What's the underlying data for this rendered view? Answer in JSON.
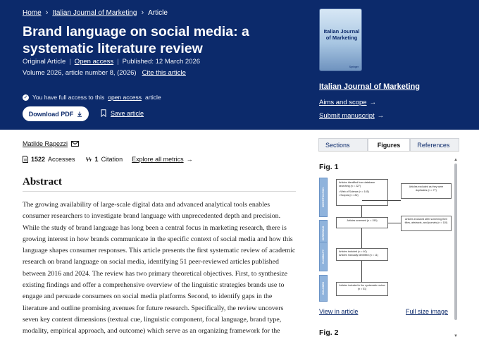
{
  "breadcrumb": {
    "home": "Home",
    "journal": "Italian Journal of Marketing",
    "current": "Article",
    "sep": "›"
  },
  "article": {
    "title": "Brand language on social media: a systematic literature review",
    "type": "Original Article",
    "access": "Open access",
    "published": "Published: 12 March 2026",
    "volume": "Volume 2026, article number 8, (2026)",
    "cite": "Cite this article",
    "full_access_pre": "You have full access to this",
    "full_access_link": "open access",
    "full_access_post": "article",
    "download": "Download PDF",
    "save": "Save article"
  },
  "journal": {
    "cover_title": "Italian Journal of Marketing",
    "cover_publisher": "Springer",
    "name": "Italian Journal of Marketing",
    "aims": "Aims and scope",
    "submit": "Submit manuscript",
    "arrow": "→"
  },
  "author": {
    "name": "Matilde Rapezzi"
  },
  "metrics": {
    "accesses_count": "1522",
    "accesses_label": "Accesses",
    "citations_count": "1",
    "citations_label": "Citation",
    "explore": "Explore all metrics"
  },
  "abstract": {
    "heading": "Abstract",
    "text": "The growing availability of large-scale digital data and advanced analytical tools enables consumer researchers to investigate brand language with unprecedented depth and precision. While the study of brand language has long been a central focus in marketing research, there is growing interest in how brands communicate in the specific context of social media and how this language shapes consumer responses. This article presents the first systematic review of academic research on brand language on social media, identifying 51 peer-reviewed articles published between 2016 and 2024. The review has two primary theoretical objectives. First, to synthesize existing findings and offer a comprehensive overview of the linguistic strategies brands use to engage and persuade consumers on social media platforms Second, to identify gaps in the literature and outline promising avenues for future research. Specifically, the review uncovers seven key content dimensions (textual cue, linguistic component, focal language, brand type, modality, empirical approach, and outcome) which serve as an organizing framework for the"
  },
  "panel": {
    "tabs": [
      "Sections",
      "Figures",
      "References"
    ],
    "fig1_label": "Fig. 1",
    "fig2_label": "Fig. 2",
    "view_in_article": "View in article",
    "full_size": "Full size image"
  },
  "prisma": {
    "phases": [
      "IDENTIFICATION",
      "SCREENING",
      "ELIGIBILITY",
      "INCLUDED"
    ],
    "box_identified": "Articles identified from database searching (n = 227)",
    "box_wos": "• Web of Science (n = 145)",
    "box_scopus": "• Scopus (n = 82)",
    "box_duplicates": "Articles excluded as they were duplicates (n = 77)",
    "box_screened": "Articles screened (n = 150)",
    "box_excluded": "Articles excluded after screening their titles, abstracts, and journals (n = 110)",
    "box_included": "Articles included (n = 40)",
    "box_manual": "Articles manually identified (n = 11)",
    "box_final": "Articles included in the systematic review (n = 51)"
  },
  "colors": {
    "banner": "#0c2a6b",
    "phase": "#8fb3dc"
  }
}
